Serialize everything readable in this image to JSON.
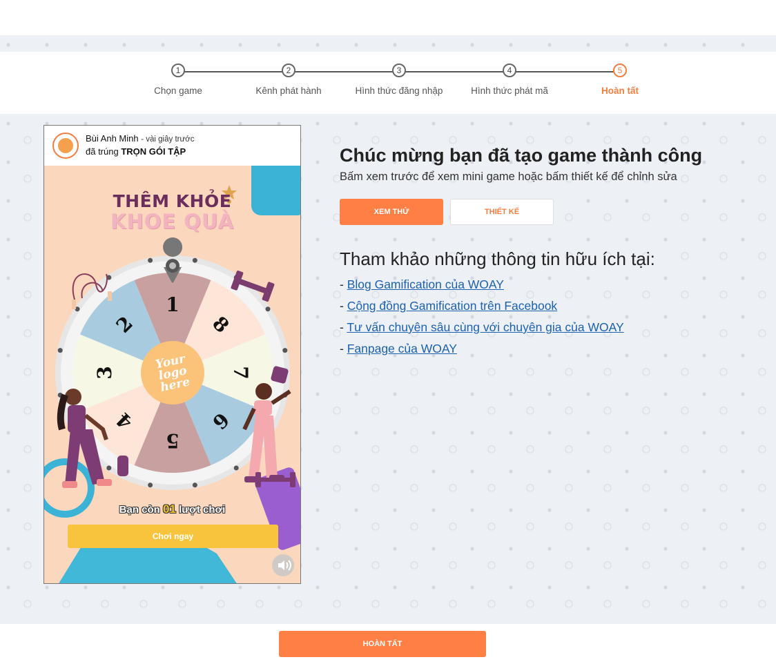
{
  "stepper": {
    "steps": [
      {
        "number": "1",
        "label": "Chọn game"
      },
      {
        "number": "2",
        "label": "Kênh phát hành"
      },
      {
        "number": "3",
        "label": "Hình thức đăng nhập"
      },
      {
        "number": "4",
        "label": "Hình thức phát mã"
      },
      {
        "number": "5",
        "label": "Hoàn tất"
      }
    ],
    "active_step": 5,
    "active_color": "#f47c3c"
  },
  "preview": {
    "notification": {
      "user": "Bùi Anh Minh",
      "time": "- vài giây trước",
      "message_prefix": "đã trúng",
      "prize": "TRỌN GÓI TẬP"
    },
    "title_line1": "THÊM KHỎE",
    "title_line2": "KHOE QUÀ",
    "wheel": {
      "segments": [
        "1",
        "8",
        "7",
        "6",
        "5",
        "4",
        "3",
        "2"
      ],
      "segment_colors": [
        "#c9a0a0",
        "#fde6d8",
        "#f7f7e6",
        "#a8cbe0",
        "#c9a0a0",
        "#fde6d8",
        "#f7f7e6",
        "#a8cbe0"
      ],
      "center_text": "Your logo here"
    },
    "remaining_prefix": "Bạn còn",
    "remaining_count": "01",
    "remaining_suffix": "lượt chơi",
    "play_button": "Chơi ngay"
  },
  "main": {
    "title": "Chúc mừng bạn đã tạo game thành công",
    "subtitle": "Bấm xem trước để xem mini game hoặc bấm thiết kế để chỉnh sửa",
    "preview_button": "XEM THỬ",
    "design_button": "THIẾT KẾ",
    "reference_title": "Tham khảo những thông tin hữu ích tại:",
    "links": [
      "Blog Gamification của WOAY",
      "Cộng đồng Gamification trên Facebook",
      "Tư vấn chuyên sâu cùng với chuyên gia của WOAY",
      "Fanpage của WOAY"
    ]
  },
  "footer": {
    "finish_button": "HOÀN TẤT"
  },
  "colors": {
    "accent": "#ff7f45",
    "link": "#1b61b0",
    "play_button": "#f8c43d"
  }
}
